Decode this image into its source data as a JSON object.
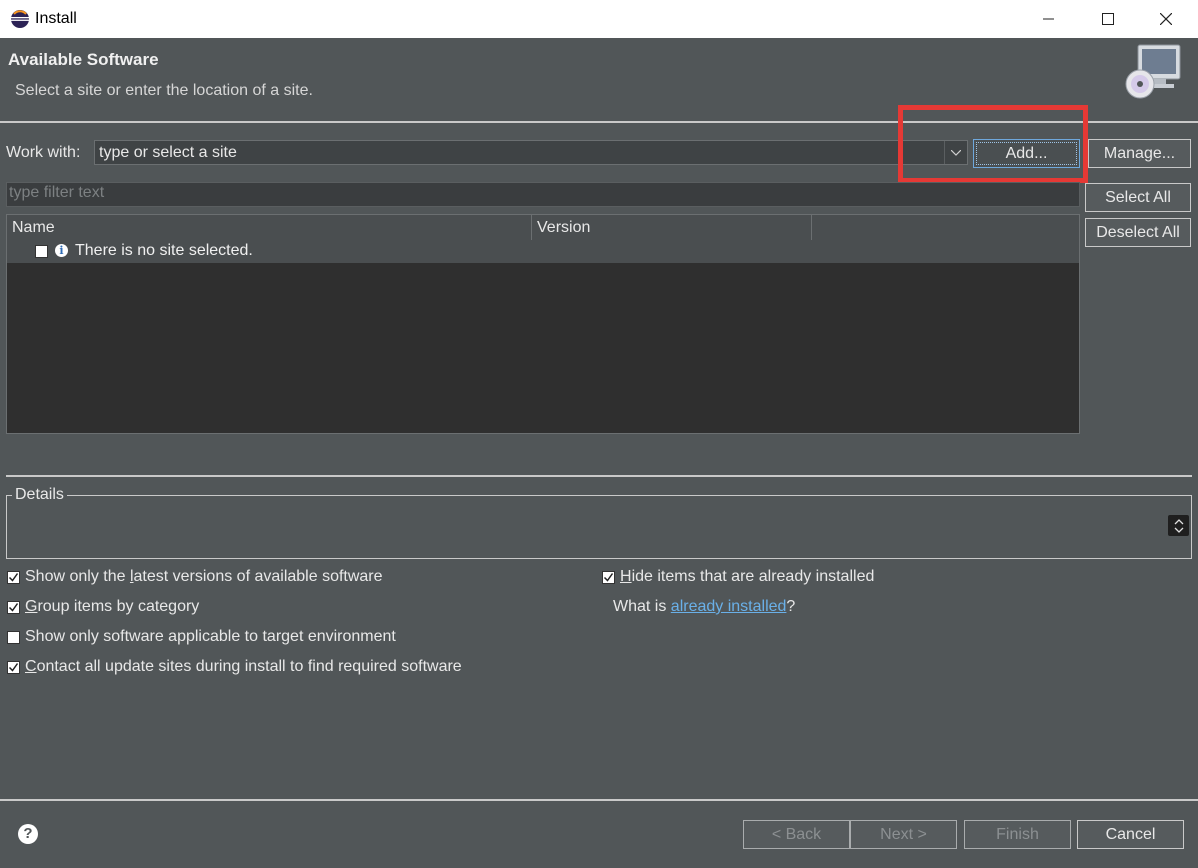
{
  "window": {
    "title": "Install",
    "icon": "eclipse-icon",
    "controls": [
      "minimize-icon",
      "maximize-icon",
      "close-icon"
    ]
  },
  "header": {
    "title": "Available Software",
    "description": "Select a site or enter the location of a site.",
    "image": "install-wizard-icon"
  },
  "work_with": {
    "label": "Work with:",
    "placeholder": "type or select a site",
    "add_label": "Add...",
    "manage_label": "Manage..."
  },
  "filter": {
    "placeholder": "type filter text"
  },
  "tree": {
    "columns": [
      "Name",
      "Version",
      ""
    ],
    "row": {
      "text": "There is no site selected.",
      "checked": false,
      "icon": "info-icon"
    }
  },
  "side_buttons": {
    "select_all": "Select All",
    "deselect_all": "Deselect All"
  },
  "details": {
    "label": "Details"
  },
  "options": {
    "left": [
      {
        "pre": "Show only the ",
        "mnemonic": "l",
        "post": "atest versions of available software",
        "checked": true
      },
      {
        "pre": "",
        "mnemonic": "G",
        "post": "roup items by category",
        "checked": true
      },
      {
        "pre": "Show only software applicable to target environment",
        "mnemonic": "",
        "post": "",
        "checked": false
      },
      {
        "pre": "",
        "mnemonic": "C",
        "post": "ontact all update sites during install to find required software",
        "checked": true
      }
    ],
    "right": [
      {
        "pre": "",
        "mnemonic": "H",
        "post": "ide items that are already installed",
        "checked": true
      }
    ],
    "what_is_pre": "What is ",
    "what_is_link": "already installed",
    "what_is_post": "?"
  },
  "footer": {
    "back": "< Back",
    "next": "Next >",
    "finish": "Finish",
    "cancel": "Cancel",
    "help_icon": "help-icon"
  },
  "colors": {
    "highlight": "#e53935",
    "link": "#6ab0e8",
    "background": "#515658"
  }
}
